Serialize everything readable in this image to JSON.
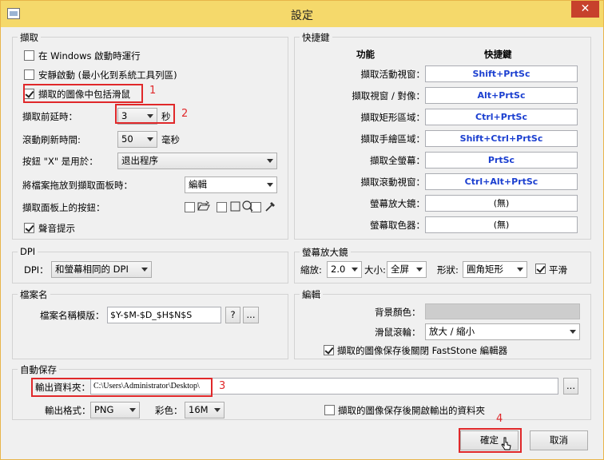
{
  "window": {
    "title": "設定",
    "close": "✕"
  },
  "capture": {
    "group_title": "擷取",
    "run_on_startup": "在 Windows 啟動時運行",
    "silent_start": "安靜啟動 (最小化到系統工具列區)",
    "include_cursor": "擷取的圖像中包括滑鼠",
    "delay_label": "擷取前延時：",
    "delay_value": "3",
    "delay_unit": "秒",
    "scroll_label": "滾動刷新時間:",
    "scroll_value": "50",
    "scroll_unit": "毫秒",
    "x_button_label": "按鈕 \"X\" 是用於：",
    "x_button_value": "退出程序",
    "drag_label": "將檔案拖放到擷取面板時：",
    "drag_value": "編輯",
    "panel_buttons_label": "擷取面板上的按鈕：",
    "sound_label": "聲音提示"
  },
  "hotkeys": {
    "group_title": "快捷鍵",
    "col_function": "功能",
    "col_hotkey": "快捷鍵",
    "rows": [
      {
        "label": "擷取活動視窗：",
        "key": "Shift+PrtSc"
      },
      {
        "label": "擷取視窗 / 對像：",
        "key": "Alt+PrtSc"
      },
      {
        "label": "擷取矩形區域：",
        "key": "Ctrl+PrtSc"
      },
      {
        "label": "擷取手繪區域：",
        "key": "Shift+Ctrl+PrtSc"
      },
      {
        "label": "擷取全螢幕：",
        "key": "PrtSc"
      },
      {
        "label": "擷取滾動視窗：",
        "key": "Ctrl+Alt+PrtSc"
      },
      {
        "label": "螢幕放大鏡：",
        "key": "(無)"
      },
      {
        "label": "螢幕取色器：",
        "key": "(無)"
      }
    ]
  },
  "dpi": {
    "group_title": "DPI",
    "label": "DPI：",
    "value": "和螢幕相同的 DPI"
  },
  "magnifier": {
    "group_title": "螢幕放大鏡",
    "zoom_label": "縮放:",
    "zoom_value": "2.0",
    "size_label": "大小:",
    "size_value": "全屏",
    "shape_label": "形狀:",
    "shape_value": "圓角矩形",
    "smooth_label": "平滑"
  },
  "filename": {
    "group_title": "檔案名",
    "template_label": "檔案名稱模版：",
    "template_value": "$Y-$M-$D_$H$N$S",
    "help_button": "?",
    "more_button": "..."
  },
  "editor": {
    "group_title": "編輯",
    "bg_label": "背景顏色：",
    "wheel_label": "滑鼠滾輪：",
    "wheel_value": "放大 / 縮小",
    "close_after_save": "擷取的圖像保存後關閉 FastStone 編輯器"
  },
  "autosave": {
    "group_title": "自動保存",
    "folder_label": "輸出資料夾：",
    "folder_value": "C:\\Users\\Administrator\\Desktop\\",
    "browse_button": "...",
    "format_label": "輸出格式：",
    "format_value": "PNG",
    "color_label": "彩色：",
    "color_value": "16M",
    "open_folder_label": "擷取的圖像保存後開啟輸出的資料夾"
  },
  "buttons": {
    "ok": "確定",
    "cancel": "取消"
  },
  "annotations": {
    "n1": "1",
    "n2": "2",
    "n3": "3",
    "n4": "4"
  },
  "colors": {
    "title_bar": "#f5d96b",
    "close": "#c7412c",
    "hotkey_text": "#1b3fd0",
    "annotation": "#e0282a"
  }
}
